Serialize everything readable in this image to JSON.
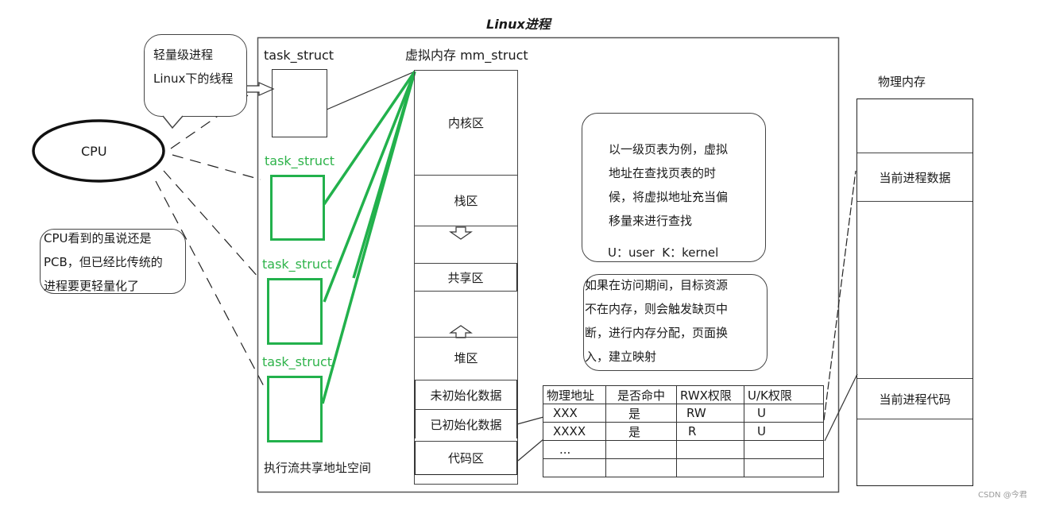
{
  "title": "Linux进程",
  "cpu": {
    "label": "CPU"
  },
  "callouts": {
    "lightweight": [
      "轻量级进程",
      "Linux下的线程"
    ],
    "cpu_view": [
      "CPU看到的虽说还是",
      "PCB，但已经比传统的",
      "进程要更轻量化了"
    ]
  },
  "process_frame": {
    "task_structs": [
      {
        "label": "task_struct",
        "color": "#1a1a1a"
      },
      {
        "label": "task_struct",
        "color": "#2eb34a"
      },
      {
        "label": "task_struct",
        "color": "#2eb34a"
      },
      {
        "label": "task_struct",
        "color": "#2eb34a"
      }
    ],
    "shared_space_label": "执行流共享地址空间",
    "mm_struct_label": "虚拟内存 mm_struct",
    "regions": [
      "内核区",
      "栈区",
      "共享区",
      "堆区",
      "未初始化数据",
      "已初始化数据",
      "代码区"
    ],
    "page_table_note": [
      "以一级页表为例，虚拟",
      "地址在查找页表的时",
      "候，将虚拟地址充当偏",
      "移量来进行查找"
    ],
    "uk_legend": "U：user  K：kernel",
    "page_fault_note": [
      "如果在访问期间，目标资源",
      "不在内存，则会触发缺页中",
      "断，进行内存分配，页面换",
      "入，建立映射"
    ],
    "page_table": {
      "headers": [
        "物理地址",
        "是否命中",
        "RWX权限",
        "U/K权限"
      ],
      "rows": [
        [
          "XXX",
          "是",
          "RW",
          "U"
        ],
        [
          "XXXX",
          "是",
          "R",
          "U"
        ],
        [
          "...",
          "",
          "",
          ""
        ],
        [
          "",
          "",
          "",
          ""
        ]
      ]
    }
  },
  "physical_memory": {
    "label": "物理内存",
    "segments": [
      "",
      "当前进程数据",
      "",
      "当前进程代码",
      ""
    ]
  },
  "watermark": "CSDN @今君",
  "colors": {
    "green": "#22b14c",
    "line": "#333333"
  }
}
